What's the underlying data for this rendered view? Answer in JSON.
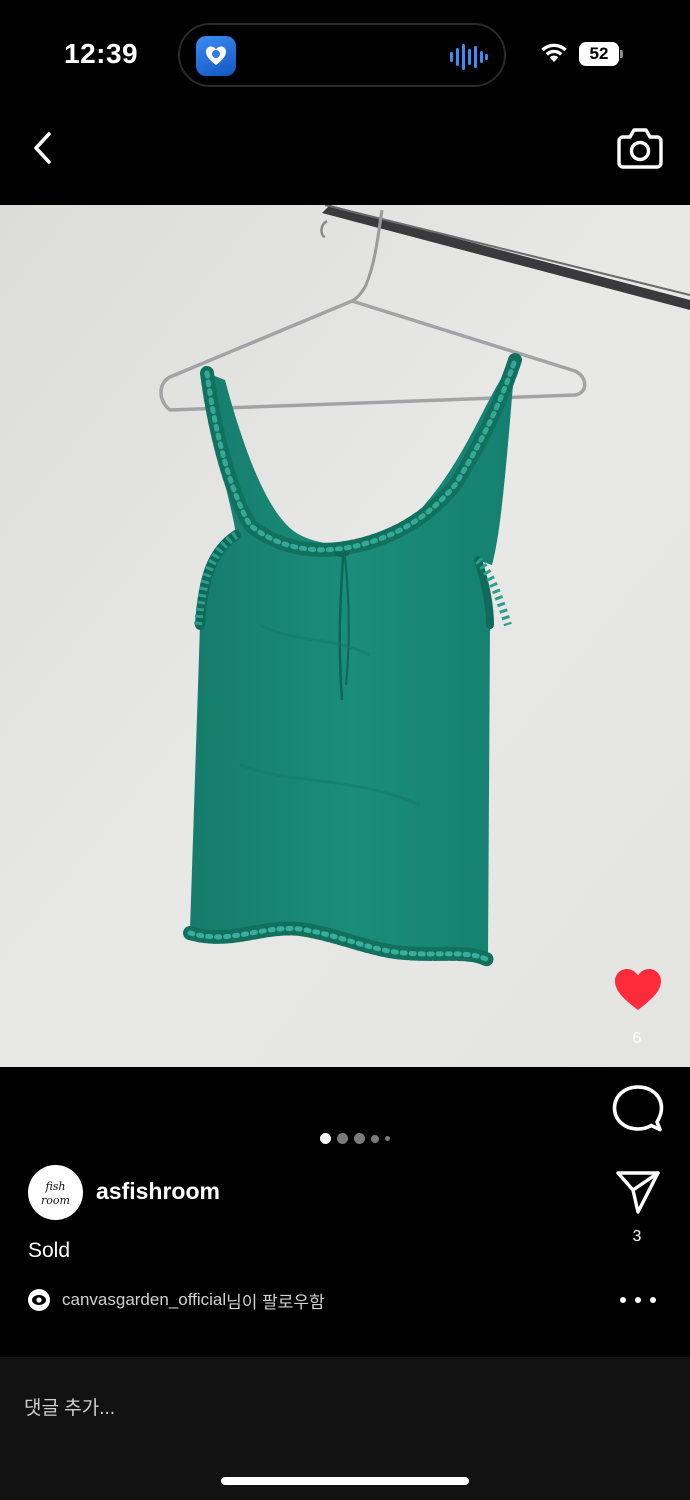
{
  "status_bar": {
    "time": "12:39",
    "battery": "52",
    "live_app_icon": "app-logo-icon",
    "live_activity_icon": "audio-waveform-icon",
    "wifi_icon": "wifi-icon"
  },
  "header": {
    "back_icon": "chevron-left-icon",
    "camera_icon": "camera-icon"
  },
  "post": {
    "image_alt": "Green ruffle-trim camisole on a wire hanger against a white wall",
    "carousel": {
      "total": 5,
      "active": 1
    },
    "like_count": "6",
    "share_count": "3",
    "liked": true,
    "like_color": "#fe2c3b",
    "author": {
      "username": "asfishroom",
      "avatar_text_top": "fish",
      "avatar_text_bottom": "room"
    },
    "caption": "Sold",
    "follow_note": {
      "account": "canvasgarden_official",
      "suffix": "님이 팔로우함"
    }
  },
  "comment_bar": {
    "placeholder": "댓글 추가..."
  }
}
